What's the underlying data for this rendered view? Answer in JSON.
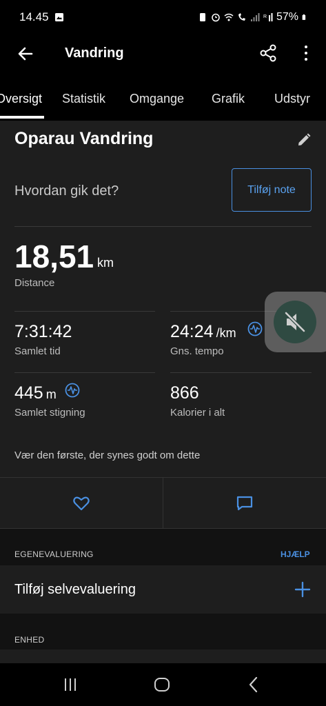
{
  "status_bar": {
    "time": "14.45",
    "battery": "57%"
  },
  "app_bar": {
    "title": "Vandring"
  },
  "tabs": [
    {
      "label": "Oversigt"
    },
    {
      "label": "Statistik"
    },
    {
      "label": "Omgange"
    },
    {
      "label": "Grafik"
    },
    {
      "label": "Udstyr"
    }
  ],
  "activity": {
    "name": "Oparau Vandring",
    "how_prompt": "Hvordan gik det?",
    "add_note": "Tilføj note"
  },
  "distance": {
    "value": "18,51",
    "unit": "km",
    "label": "Distance"
  },
  "stats": {
    "total_time": {
      "value": "7:31:42",
      "label": "Samlet tid"
    },
    "avg_pace": {
      "value": "24:24",
      "unit": "/km",
      "label": "Gns. tempo"
    },
    "ascent": {
      "value": "445",
      "unit": "m",
      "label": "Samlet stigning"
    },
    "calories": {
      "value": "866",
      "label": "Kalorier i alt"
    }
  },
  "social": {
    "first_like": "Vær den første, der synes godt om dette"
  },
  "self_eval": {
    "section_title": "EGENEVALUERING",
    "help": "HJÆLP",
    "add_label": "Tilføj selvevaluering"
  },
  "device": {
    "section_title": "ENHED"
  },
  "colors": {
    "accent": "#4a90e2",
    "background": "#1e1e1e",
    "section_bg": "#121212"
  },
  "icons": [
    "back-arrow-icon",
    "share-icon",
    "more-vert-icon",
    "edit-pencil-icon",
    "heart-rate-icon",
    "heart-icon",
    "comment-icon",
    "plus-icon",
    "mute-icon"
  ]
}
